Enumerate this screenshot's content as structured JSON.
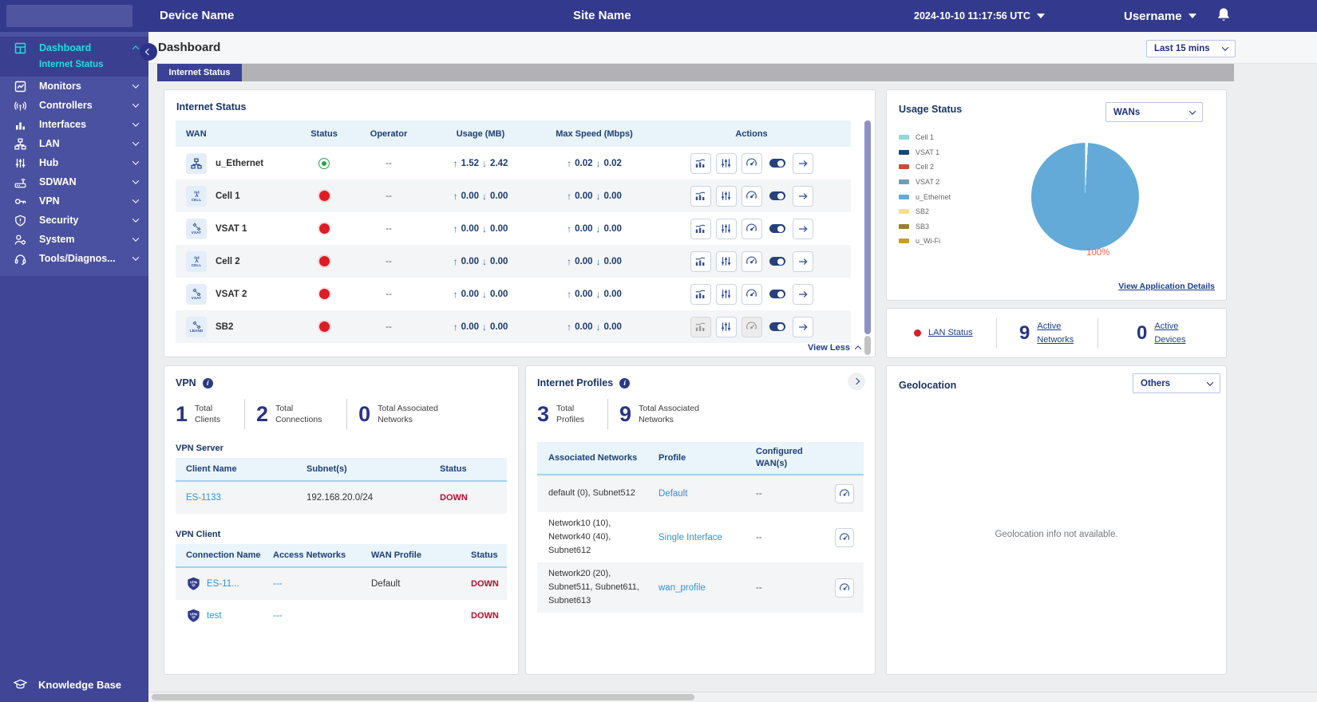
{
  "theme": {
    "header_bg": "#333a8e",
    "sidebar_bg": "#4a51a0",
    "accent_cyan": "#22dede",
    "navy_text": "#1a3565",
    "link_blue": "#2e93d8",
    "status_red": "#dc1d23",
    "status_green": "#29a347",
    "down_red": "#c00a2d",
    "pie_blue": "#63aad9"
  },
  "header": {
    "device_name": "Device Name",
    "site_name": "Site Name",
    "timestamp": "2024-10-10 11:17:56 UTC",
    "username": "Username"
  },
  "sidebar": {
    "items": [
      {
        "label": "Dashboard"
      },
      {
        "label": "Internet Status"
      },
      {
        "label": "Monitors"
      },
      {
        "label": "Controllers"
      },
      {
        "label": "Interfaces"
      },
      {
        "label": "LAN"
      },
      {
        "label": "Hub"
      },
      {
        "label": "SDWAN"
      },
      {
        "label": "VPN"
      },
      {
        "label": "Security"
      },
      {
        "label": "System"
      },
      {
        "label": "Tools/Diagnos..."
      }
    ],
    "knowledge_base": "Knowledge Base"
  },
  "page": {
    "title": "Dashboard",
    "time_filter": "Last 15 mins",
    "tab": "Internet Status"
  },
  "internet_status": {
    "title": "Internet Status",
    "columns": [
      "WAN",
      "Status",
      "Operator",
      "Usage (MB)",
      "Max Speed (Mbps)",
      "Actions"
    ],
    "rows": [
      {
        "name": "u_Ethernet",
        "badge": "",
        "status": "up",
        "operator": "--",
        "usage_up": "1.52",
        "usage_down": "2.42",
        "speed_up": "0.02",
        "speed_down": "0.02",
        "actions_disabled": false
      },
      {
        "name": "Cell 1",
        "badge": "CELL",
        "status": "down",
        "operator": "--",
        "usage_up": "0.00",
        "usage_down": "0.00",
        "speed_up": "0.00",
        "speed_down": "0.00",
        "actions_disabled": false
      },
      {
        "name": "VSAT 1",
        "badge": "VSAT",
        "status": "down",
        "operator": "--",
        "usage_up": "0.00",
        "usage_down": "0.00",
        "speed_up": "0.00",
        "speed_down": "0.00",
        "actions_disabled": false
      },
      {
        "name": "Cell 2",
        "badge": "CELL",
        "status": "down",
        "operator": "--",
        "usage_up": "0.00",
        "usage_down": "0.00",
        "speed_up": "0.00",
        "speed_down": "0.00",
        "actions_disabled": false
      },
      {
        "name": "VSAT 2",
        "badge": "VSAT",
        "status": "down",
        "operator": "--",
        "usage_up": "0.00",
        "usage_down": "0.00",
        "speed_up": "0.00",
        "speed_down": "0.00",
        "actions_disabled": false
      },
      {
        "name": "SB2",
        "badge": "LBAND",
        "status": "down",
        "operator": "--",
        "usage_up": "0.00",
        "usage_down": "0.00",
        "speed_up": "0.00",
        "speed_down": "0.00",
        "actions_disabled": true
      }
    ],
    "view_less": "View Less"
  },
  "usage_status": {
    "title": "Usage Status",
    "filter": "WANs",
    "link": "View Application Details",
    "chart_data": {
      "type": "pie",
      "labels": [
        "Cell 1",
        "VSAT 1",
        "Cell 2",
        "VSAT 2",
        "u_Ethernet",
        "SB2",
        "SB3",
        "u_Wi-Fi"
      ],
      "values": [
        0,
        0,
        0,
        0,
        100,
        0,
        0,
        0
      ],
      "colors": [
        "#8fd7d3",
        "#16497c",
        "#c84b38",
        "#6f9cb8",
        "#63aad9",
        "#f9dd8e",
        "#9d7f26",
        "#c49d27"
      ],
      "annotation": "100%",
      "legend_position": "left"
    }
  },
  "lan_summary": {
    "lan_status_label": "LAN Status",
    "active_networks_value": "9",
    "active_networks_label": "Active Networks",
    "active_devices_value": "0",
    "active_devices_label": "Active Devices"
  },
  "vpn": {
    "title": "VPN",
    "stats": [
      {
        "value": "1",
        "label": "Total Clients"
      },
      {
        "value": "2",
        "label": "Total Connections"
      },
      {
        "value": "0",
        "label": "Total Associated Networks"
      }
    ],
    "server": {
      "title": "VPN Server",
      "columns": [
        "Client Name",
        "Subnet(s)",
        "Status"
      ],
      "rows": [
        {
          "client": "ES-1133",
          "subnets": "192.168.20.0/24",
          "status": "DOWN"
        }
      ]
    },
    "client": {
      "title": "VPN Client",
      "columns": [
        "Connection Name",
        "Access Networks",
        "WAN Profile",
        "Status"
      ],
      "rows": [
        {
          "connection": "ES-11...",
          "access": "---",
          "wan_profile": "Default",
          "status": "DOWN"
        },
        {
          "connection": "test",
          "access": "---",
          "wan_profile": "",
          "status": "DOWN"
        }
      ]
    }
  },
  "internet_profiles": {
    "title": "Internet Profiles",
    "stats": [
      {
        "value": "3",
        "label": "Total Profiles"
      },
      {
        "value": "9",
        "label": "Total Associated Networks"
      }
    ],
    "columns": [
      "Associated Networks",
      "Profile",
      "Configured WAN(s)"
    ],
    "rows": [
      {
        "networks": "default (0), Subnet512",
        "profile": "Default",
        "configured": "--"
      },
      {
        "networks": "Network10 (10), Network40 (40), Subnet612",
        "profile": "Single Interface",
        "configured": "--"
      },
      {
        "networks": "Network20 (20), Subnet511, Subnet611, Subnet613",
        "profile": "wan_profile",
        "configured": "--"
      }
    ]
  },
  "geolocation": {
    "title": "Geolocation",
    "filter": "Others",
    "empty": "Geolocation info not available."
  }
}
